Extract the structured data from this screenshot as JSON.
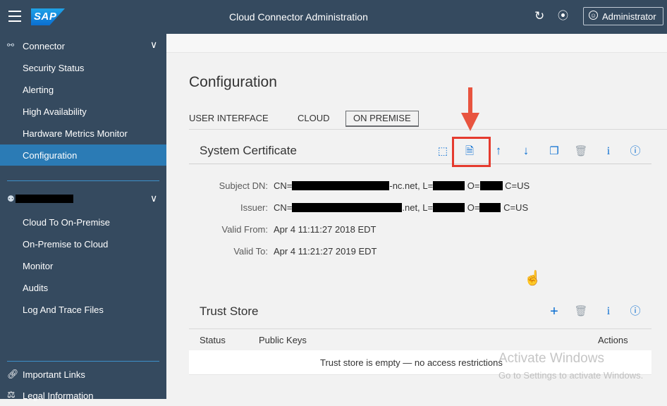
{
  "shell": {
    "logo_text": "SAP",
    "title": "Cloud Connector Administration",
    "user_label": "Administrator",
    "icons": [
      "menu-icon",
      "refresh-icon",
      "logout-icon",
      "user-icon"
    ]
  },
  "sidebar": {
    "connector_group": {
      "label": "Connector",
      "items": [
        {
          "label": "Security Status"
        },
        {
          "label": "Alerting"
        },
        {
          "label": "High Availability"
        },
        {
          "label": "Hardware Metrics Monitor"
        },
        {
          "label": "Configuration",
          "selected": true
        }
      ]
    },
    "subaccount_group": {
      "items": [
        {
          "label": "Cloud To On-Premise"
        },
        {
          "label": "On-Premise to Cloud"
        },
        {
          "label": "Monitor"
        },
        {
          "label": "Audits"
        },
        {
          "label": "Log And Trace Files"
        }
      ]
    },
    "footer": [
      {
        "label": "Important Links"
      },
      {
        "label": "Legal Information"
      }
    ]
  },
  "main": {
    "title": "Configuration",
    "tabs": [
      {
        "label": "USER INTERFACE"
      },
      {
        "label": "CLOUD"
      },
      {
        "label": "ON PREMISE",
        "active": true
      }
    ],
    "system_certificate": {
      "title": "System Certificate",
      "fields": [
        {
          "label": "Subject DN:",
          "parts": [
            "CN=",
            "-nc.net, L=",
            "O=",
            "C=US"
          ]
        },
        {
          "label": "Issuer:",
          "parts": [
            "CN=",
            ".net, L=",
            "O=",
            "C=US"
          ]
        },
        {
          "label": "Valid From:",
          "value": "Apr 4 11:11:27 2018 EDT"
        },
        {
          "label": "Valid To:",
          "value": "Apr 4 11:21:27 2019 EDT"
        }
      ],
      "toolbar_icons": [
        "generate-csr-icon",
        "create-certificate-icon",
        "upload-icon",
        "download-icon",
        "copy-icon",
        "delete-icon",
        "info-icon",
        "help-icon"
      ]
    },
    "trust_store": {
      "title": "Trust Store",
      "columns": [
        "Status",
        "Public Keys",
        "Actions"
      ],
      "empty_text": "Trust store is empty — no access restrictions",
      "toolbar_icons": [
        "add-icon",
        "delete-icon",
        "info-icon",
        "help-icon"
      ]
    }
  },
  "watermark": {
    "line1": "Activate Windows",
    "line2": "Go to Settings to activate Windows."
  },
  "colors": {
    "shell_bg": "#354a5f",
    "selected_item": "#2b7bb5",
    "highlight_red": "#e53b2f",
    "icon_blue": "#0a6ed1"
  }
}
